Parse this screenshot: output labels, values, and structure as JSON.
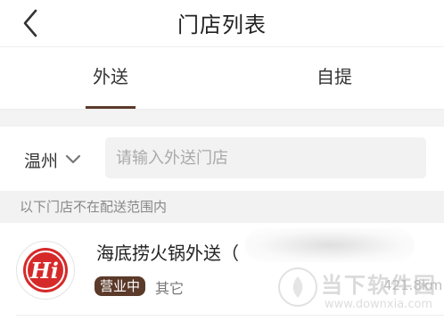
{
  "header": {
    "title": "门店列表",
    "back_icon": "chevron-left-icon"
  },
  "tabs": [
    {
      "label": "外送",
      "active": true
    },
    {
      "label": "自提",
      "active": false
    }
  ],
  "filter": {
    "city": "温州",
    "city_dropdown_icon": "chevron-down-icon",
    "search_placeholder": "请输入外送门店",
    "search_value": ""
  },
  "notice": "以下门店不在配送范围内",
  "stores": [
    {
      "name": "海底捞火锅外送（",
      "logo_text": "Hi",
      "status": "营业中",
      "tag": "其它",
      "distance": "421.8km"
    }
  ],
  "watermark": {
    "title": "当下软件园",
    "url": "www.downxia.com"
  },
  "colors": {
    "accent": "#5b3a2a",
    "logo_red": "#d62a2a",
    "notice_bg": "#f2f2f2"
  }
}
